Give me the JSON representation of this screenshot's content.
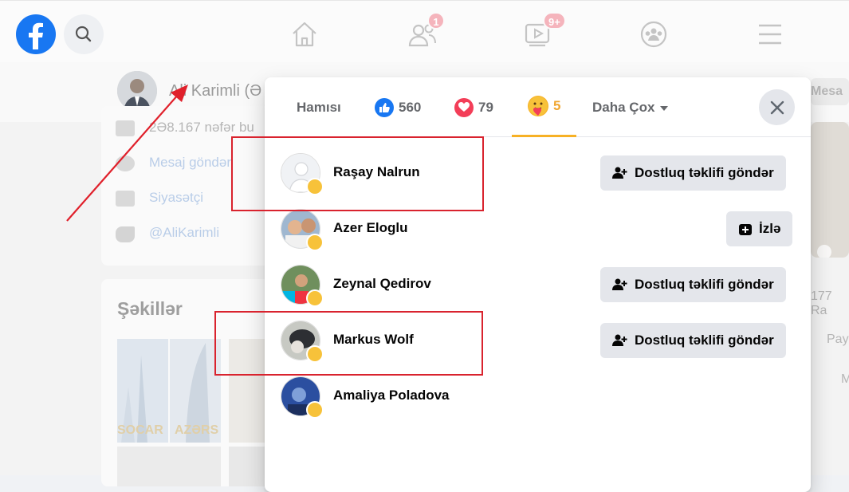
{
  "topbar": {
    "badges": {
      "friends": "1",
      "watch": "9+"
    }
  },
  "profile": {
    "name": "Ali Karimli (Ə",
    "intro": [
      {
        "text": "2Ə8.167 nəfər bu",
        "kind": "text"
      },
      {
        "text": "Mesaj göndər",
        "kind": "link"
      },
      {
        "text": "Siyasətçi",
        "kind": "link"
      },
      {
        "text": "@AliKarimli",
        "kind": "link"
      }
    ],
    "photos_title": "Şəkillər",
    "photo_labels": [
      "SOCAR",
      "AZƏRS"
    ],
    "right_ghost": {
      "message": "Mesa",
      "count": "177 Ra",
      "share": "Pay",
      "more": "M"
    }
  },
  "modal": {
    "tabs": {
      "all": "Hamısı",
      "like_count": "560",
      "love_count": "79",
      "care_count": "5",
      "more": "Daha Çox"
    },
    "rows": [
      {
        "name": "Raşay Nalrun",
        "action": "Dostluq təklifi göndər",
        "action_type": "add-friend",
        "avatar": "default"
      },
      {
        "name": "Azer Eloglu",
        "action": "İzlə",
        "action_type": "follow",
        "avatar": "photo"
      },
      {
        "name": "Zeynal Qedirov",
        "action": "Dostluq təklifi göndər",
        "action_type": "add-friend",
        "avatar": "photo"
      },
      {
        "name": "Markus Wolf",
        "action": "Dostluq təklifi göndər",
        "action_type": "add-friend",
        "avatar": "photo"
      },
      {
        "name": "Amaliya Poladova",
        "action": "",
        "action_type": "none",
        "avatar": "photo"
      }
    ]
  },
  "colors": {
    "brand": "#1877f2",
    "care_active": "#f7b125",
    "highlight": "#d9232e",
    "love": "#f33e58"
  }
}
